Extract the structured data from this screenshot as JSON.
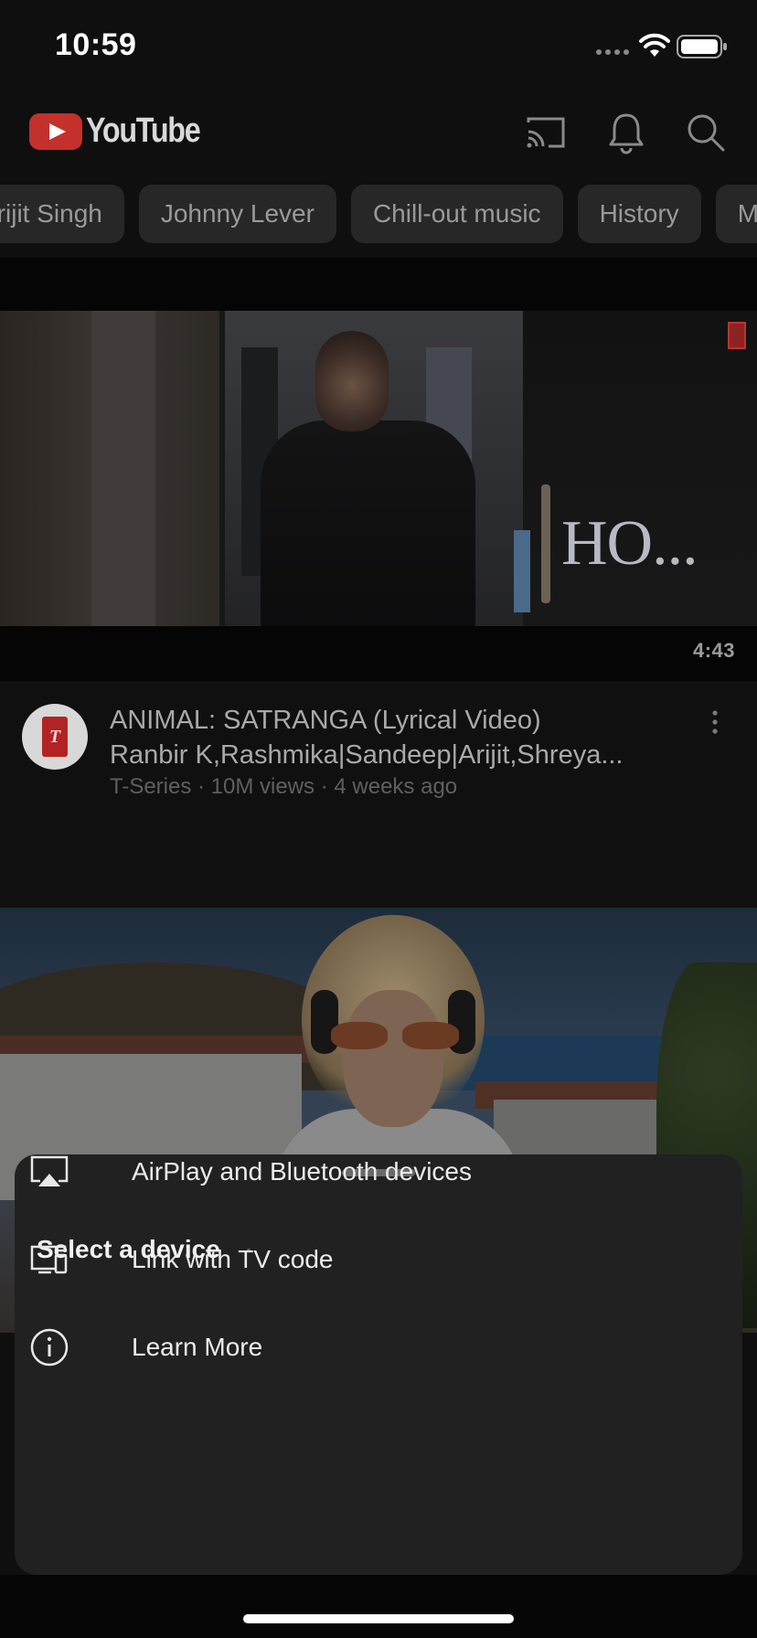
{
  "status_bar": {
    "time": "10:59",
    "signal_icon": "signal-dots-icon",
    "wifi_icon": "wifi-icon",
    "battery_icon": "battery-icon"
  },
  "header": {
    "logo_text": "YouTube",
    "icons": [
      "cast-icon",
      "bell-icon",
      "search-icon"
    ]
  },
  "chips": [
    "Arijit Singh",
    "Johnny Lever",
    "Chill-out music",
    "History",
    "M"
  ],
  "videos": [
    {
      "thumbnail_text": "HO...",
      "duration": "4:43",
      "title_line1": "ANIMAL: SATRANGA (Lyrical Video)",
      "title_line2": "Ranbir K,Rashmika|Sandeep|Arijit,Shreya...",
      "meta": "T-Series · 10M views · 4 weeks ago",
      "channel_initial": "T"
    }
  ],
  "sheet": {
    "title": "Select a device",
    "items": [
      {
        "label": "AirPlay and Bluetooth devices",
        "icon": "airplay-icon"
      },
      {
        "label": "Link with TV code",
        "icon": "tv-code-icon"
      },
      {
        "label": "Learn More",
        "icon": "info-icon"
      }
    ]
  },
  "colors": {
    "background": "#0f0f0f",
    "sheet": "#212121",
    "chip": "#272727",
    "brand_red": "#c4302b"
  }
}
